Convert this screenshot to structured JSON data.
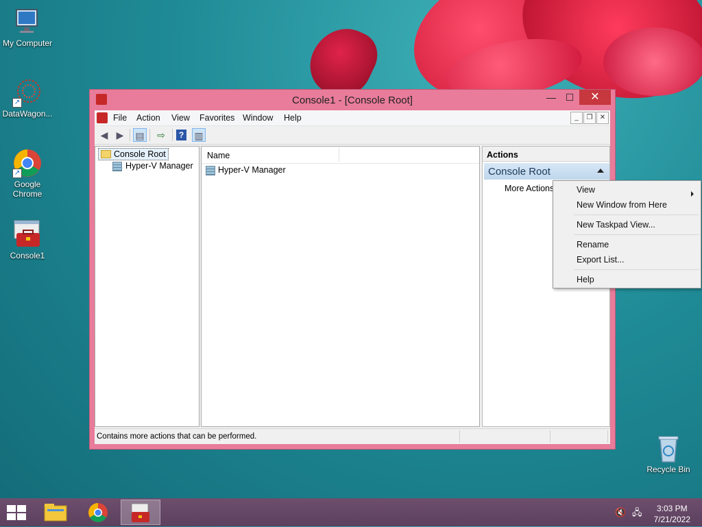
{
  "desktop": {
    "icons": [
      {
        "label": "My Computer"
      },
      {
        "label": "DataWagon..."
      },
      {
        "label": "Google Chrome"
      },
      {
        "label": "Console1"
      },
      {
        "label": "Recycle Bin"
      }
    ]
  },
  "window": {
    "title": "Console1 - [Console Root]",
    "controls": {
      "minimize": "—",
      "maximize": "☐",
      "close": "✕"
    },
    "menu": [
      "File",
      "Action",
      "View",
      "Favorites",
      "Window",
      "Help"
    ],
    "mdi_controls": {
      "minimize": "_",
      "restore": "❐",
      "close": "✕"
    },
    "tree": {
      "root": "Console Root",
      "children": [
        "Hyper-V Manager"
      ]
    },
    "list": {
      "column_name": "Name",
      "rows": [
        "Hyper-V Manager"
      ]
    },
    "actions": {
      "header": "Actions",
      "section": "Console Root",
      "items": [
        "More Actions"
      ]
    },
    "status": "Contains more actions that can be performed."
  },
  "context_menu": {
    "items": [
      "View",
      "New Window from Here",
      "New Taskpad View...",
      "Rename",
      "Export List...",
      "Help"
    ]
  },
  "taskbar": {
    "time": "3:03 PM",
    "date": "7/21/2022"
  },
  "colors": {
    "window_frame": "#e87c9a",
    "close_button": "#c7373e",
    "selection": "#e5f1fb"
  }
}
